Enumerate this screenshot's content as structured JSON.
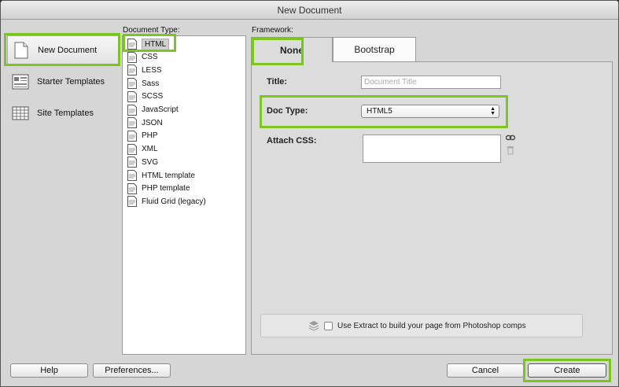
{
  "window": {
    "title": "New Document"
  },
  "categories": [
    {
      "label": "New Document",
      "icon": "blank-page-icon",
      "selected": true
    },
    {
      "label": "Starter Templates",
      "icon": "starter-templates-icon",
      "selected": false
    },
    {
      "label": "Site Templates",
      "icon": "site-templates-icon",
      "selected": false
    }
  ],
  "document_type": {
    "label": "Document Type:",
    "items": [
      "HTML",
      "CSS",
      "LESS",
      "Sass",
      "SCSS",
      "JavaScript",
      "JSON",
      "PHP",
      "XML",
      "SVG",
      "HTML template",
      "PHP template",
      "Fluid Grid (legacy)"
    ],
    "selected": "HTML"
  },
  "framework": {
    "label": "Framework:",
    "tabs": [
      "None",
      "Bootstrap"
    ],
    "active_tab": "None"
  },
  "form": {
    "title_label": "Title:",
    "title_value": "",
    "title_placeholder": "Document Title",
    "doctype_label": "Doc Type:",
    "doctype_value": "HTML5",
    "attach_css_label": "Attach CSS:"
  },
  "extract": {
    "label": "Use Extract to build your page from Photoshop comps",
    "checked": false
  },
  "buttons": {
    "help": "Help",
    "preferences": "Preferences...",
    "cancel": "Cancel",
    "create": "Create"
  },
  "colors": {
    "highlight": "#7cc521"
  }
}
